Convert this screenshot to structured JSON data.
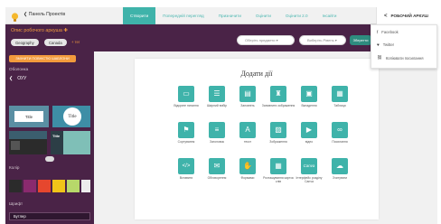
{
  "topbar": {
    "back_link": "❮ Панель Проектів",
    "tabs": [
      {
        "label": "Створити"
      },
      {
        "label": "Попередній перегляд"
      },
      {
        "label": "Призначити"
      },
      {
        "label": "Оцінити"
      },
      {
        "label": "Оцінити 2.0"
      },
      {
        "label": "Інсайти"
      }
    ],
    "share_label": "РОБОЧИЙ АРКУШ"
  },
  "header": {
    "worksheet_title": "Опис робочого аркуша ✚",
    "chips": [
      "Geography",
      "Canada"
    ],
    "add_tag": "+ тег",
    "grade_placeholder": "Оберіть предмети ▾",
    "level_placeholder": "Виберіть Рівень ▾",
    "save_label": "Зберегти"
  },
  "share_menu": {
    "items": [
      {
        "label": "Facebook",
        "icon": "facebook-icon",
        "glyph": "f"
      },
      {
        "label": "Twitter",
        "icon": "twitter-icon",
        "glyph": "♥"
      },
      {
        "label": "Копіювати посилання",
        "icon": "link-icon",
        "glyph": "⛓"
      }
    ]
  },
  "sidebar": {
    "orange_button": "ЗМІНИТИ ПОВНІСТЮ ШАБЛОНИ",
    "section_title": "Оболонка",
    "back_label": "ОУУ",
    "tile_titles": [
      "Title",
      "Title",
      "Title"
    ],
    "color_heading": "Колір",
    "swatch_colors": [
      "#2b2b2b",
      "#8a2a6e",
      "#e6472e",
      "#f0c419",
      "#b7d86a",
      "#ececec"
    ],
    "font_heading": "Шрифт",
    "font_value": "Бутлер"
  },
  "canvas": {
    "title": "Додати дії",
    "items": [
      {
        "label": "Відкрите питання",
        "glyph": "▭"
      },
      {
        "label": "Шкірний вибір",
        "glyph": "☰"
      },
      {
        "label": "Заповніть",
        "glyph": "▤"
      },
      {
        "label": "Заповнити зображення",
        "glyph": "♜"
      },
      {
        "label": "Вкладення",
        "glyph": "▣"
      },
      {
        "label": "Таблиця",
        "glyph": "▦"
      },
      {
        "label": "Сортування",
        "glyph": "⚑"
      },
      {
        "label": "Заголовок",
        "glyph": "≡"
      },
      {
        "label": "текст",
        "glyph": "A"
      },
      {
        "label": "Зображення",
        "glyph": "▨"
      },
      {
        "label": "відео",
        "glyph": "▶"
      },
      {
        "label": "Посилання",
        "glyph": "∞"
      },
      {
        "label": "Вставити",
        "glyph": "</>"
      },
      {
        "label": "Обговорення",
        "glyph": "✉"
      },
      {
        "label": "Формами",
        "glyph": "✋"
      },
      {
        "label": "Розташування карток слів",
        "glyph": "▦"
      },
      {
        "label": "Інтерфейс розділу Canva",
        "glyph": "Canva"
      },
      {
        "label": "Зчитувати",
        "glyph": "☁"
      }
    ]
  }
}
